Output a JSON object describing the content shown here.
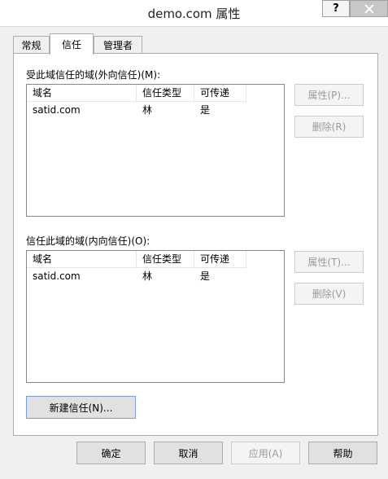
{
  "window": {
    "title": "demo.com 属性",
    "help_glyph": "?"
  },
  "tabs": [
    {
      "label": "常规",
      "active": false
    },
    {
      "label": "信任",
      "active": true
    },
    {
      "label": "管理者",
      "active": false
    }
  ],
  "outgoing": {
    "label": "受此域信任的域(外向信任)(M):",
    "columns": [
      "域名",
      "信任类型",
      "可传递"
    ],
    "rows": [
      {
        "domain": "satid.com",
        "type": "林",
        "transitive": "是"
      }
    ],
    "buttons": {
      "properties": "属性(P)...",
      "remove": "删除(R)"
    }
  },
  "incoming": {
    "label": "信任此域的域(内向信任)(O):",
    "columns": [
      "域名",
      "信任类型",
      "可传递"
    ],
    "rows": [
      {
        "domain": "satid.com",
        "type": "林",
        "transitive": "是"
      }
    ],
    "buttons": {
      "properties": "属性(T)...",
      "remove": "删除(V)"
    }
  },
  "new_trust_label": "新建信任(N)...",
  "footer": {
    "ok": "确定",
    "cancel": "取消",
    "apply": "应用(A)",
    "help": "帮助"
  }
}
